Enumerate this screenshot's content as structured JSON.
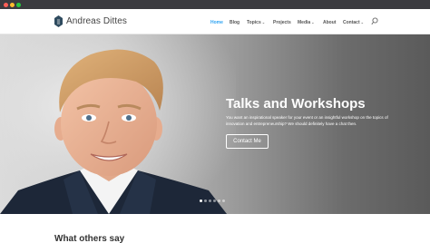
{
  "header": {
    "brand": "Andreas Dittes",
    "nav": [
      {
        "label": "Home",
        "active": true,
        "dropdown": false
      },
      {
        "label": "Blog",
        "active": false,
        "dropdown": false
      },
      {
        "label": "Topics",
        "active": false,
        "dropdown": true
      },
      {
        "label": "Projects",
        "active": false,
        "dropdown": false
      },
      {
        "label": "Media",
        "active": false,
        "dropdown": true
      },
      {
        "label": "About",
        "active": false,
        "dropdown": false
      },
      {
        "label": "Contact",
        "active": false,
        "dropdown": true
      }
    ],
    "caret": "⌄",
    "search_icon": "search-icon"
  },
  "hero": {
    "title": "Talks and Workshops",
    "text": "You want an inspirational speaker for your event or an insightful workshop on the topics of innovation and entrepreneurship? We should definitely have a chat then.",
    "button": "Contact Me",
    "slide_count": 6,
    "active_slide": 1
  },
  "section": {
    "heading": "What others say"
  },
  "colors": {
    "accent": "#2ea3f2",
    "logo": "#2f4b5f"
  }
}
